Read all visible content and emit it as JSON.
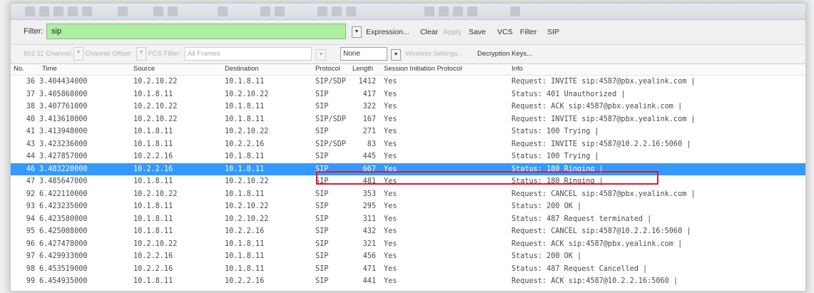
{
  "filter_toolbar": {
    "filter_label": "Filter:",
    "filter_value": "sip",
    "expression_label": "Expression...",
    "clear_label": "Clear",
    "apply_label": "Apply",
    "save_label": "Save",
    "vcs_label": "VCS",
    "filter_button_label": "Filter",
    "sip_label": "SIP",
    "filter_color": "#afefa0"
  },
  "wireless_toolbar": {
    "channel_label": "802.11 Channel:",
    "channel_offset_label": "Channel Offset:",
    "fcs_filter_label": "FCS Filter:",
    "fcs_filter_value": "All Frames",
    "none_value": "None",
    "wireless_settings_label": "Wireless Settings...",
    "decryption_keys_label": "Decryption Keys..."
  },
  "packet_list": {
    "columns": [
      "No.",
      "Time",
      "Source",
      "Destination",
      "Protocol",
      "Length",
      "Session Initiation Protocol",
      "Info"
    ],
    "selection_color": "#3399ff",
    "highlight_color": "#e01b2b",
    "selected_index": 7,
    "rows": [
      {
        "no": "36",
        "time": "3.404434000",
        "source": "10.2.10.22",
        "destination": "10.1.8.11",
        "protocol": "SIP/SDP",
        "length": "1412",
        "sip": "Yes",
        "info": "Request: INVITE sip:4587@pbx.yealink.com |"
      },
      {
        "no": "37",
        "time": "3.405868000",
        "source": "10.1.8.11",
        "destination": "10.2.10.22",
        "protocol": "SIP",
        "length": "417",
        "sip": "Yes",
        "info": "Status: 401 Unauthorized |"
      },
      {
        "no": "38",
        "time": "3.407761000",
        "source": "10.2.10.22",
        "destination": "10.1.8.11",
        "protocol": "SIP",
        "length": "322",
        "sip": "Yes",
        "info": "Request: ACK sip:4587@pbx.yealink.com |"
      },
      {
        "no": "40",
        "time": "3.413610000",
        "source": "10.2.10.22",
        "destination": "10.1.8.11",
        "protocol": "SIP/SDP",
        "length": "167",
        "sip": "Yes",
        "info": "Request: INVITE sip:4587@pbx.yealink.com |"
      },
      {
        "no": "41",
        "time": "3.413948000",
        "source": "10.1.8.11",
        "destination": "10.2.10.22",
        "protocol": "SIP",
        "length": "271",
        "sip": "Yes",
        "info": "Status: 100 Trying |"
      },
      {
        "no": "43",
        "time": "3.423236000",
        "source": "10.1.8.11",
        "destination": "10.2.2.16",
        "protocol": "SIP/SDP",
        "length": "83",
        "sip": "Yes",
        "info": "Request: INVITE sip:4587@10.2.2.16:5060 |"
      },
      {
        "no": "44",
        "time": "3.427857000",
        "source": "10.2.2.16",
        "destination": "10.1.8.11",
        "protocol": "SIP",
        "length": "445",
        "sip": "Yes",
        "info": "Status: 100 Trying |"
      },
      {
        "no": "46",
        "time": "3.483220000",
        "source": "10.2.2.16",
        "destination": "10.1.8.11",
        "protocol": "SIP",
        "length": "667",
        "sip": "Yes",
        "info": "Status: 180 Ringing |"
      },
      {
        "no": "47",
        "time": "3.485647000",
        "source": "10.1.8.11",
        "destination": "10.2.10.22",
        "protocol": "SIP",
        "length": "481",
        "sip": "Yes",
        "info": "Status: 180 Ringing |"
      },
      {
        "no": "92",
        "time": "6.422110000",
        "source": "10.2.10.22",
        "destination": "10.1.8.11",
        "protocol": "SIP",
        "length": "353",
        "sip": "Yes",
        "info": "Request: CANCEL sip:4587@pbx.yealink.com |"
      },
      {
        "no": "93",
        "time": "6.423235000",
        "source": "10.1.8.11",
        "destination": "10.2.10.22",
        "protocol": "SIP",
        "length": "295",
        "sip": "Yes",
        "info": "Status: 200 OK |"
      },
      {
        "no": "94",
        "time": "6.423580000",
        "source": "10.1.8.11",
        "destination": "10.2.10.22",
        "protocol": "SIP",
        "length": "311",
        "sip": "Yes",
        "info": "Status: 487 Request terminated |"
      },
      {
        "no": "95",
        "time": "6.425008000",
        "source": "10.1.8.11",
        "destination": "10.2.2.16",
        "protocol": "SIP",
        "length": "432",
        "sip": "Yes",
        "info": "Request: CANCEL sip:4587@10.2.2.16:5060 |"
      },
      {
        "no": "96",
        "time": "6.427478000",
        "source": "10.2.10.22",
        "destination": "10.1.8.11",
        "protocol": "SIP",
        "length": "321",
        "sip": "Yes",
        "info": "Request: ACK sip:4587@pbx.yealink.com |"
      },
      {
        "no": "97",
        "time": "6.429933000",
        "source": "10.2.2.16",
        "destination": "10.1.8.11",
        "protocol": "SIP",
        "length": "456",
        "sip": "Yes",
        "info": "Status: 200 OK |"
      },
      {
        "no": "98",
        "time": "6.453519000",
        "source": "10.2.2.16",
        "destination": "10.1.8.11",
        "protocol": "SIP",
        "length": "471",
        "sip": "Yes",
        "info": "Status: 487 Request Cancelled |"
      },
      {
        "no": "99",
        "time": "6.454935000",
        "source": "10.1.8.11",
        "destination": "10.2.2.16",
        "protocol": "SIP",
        "length": "441",
        "sip": "Yes",
        "info": "Request: ACK sip:4587@10.2.2.16:5060 |"
      }
    ]
  }
}
